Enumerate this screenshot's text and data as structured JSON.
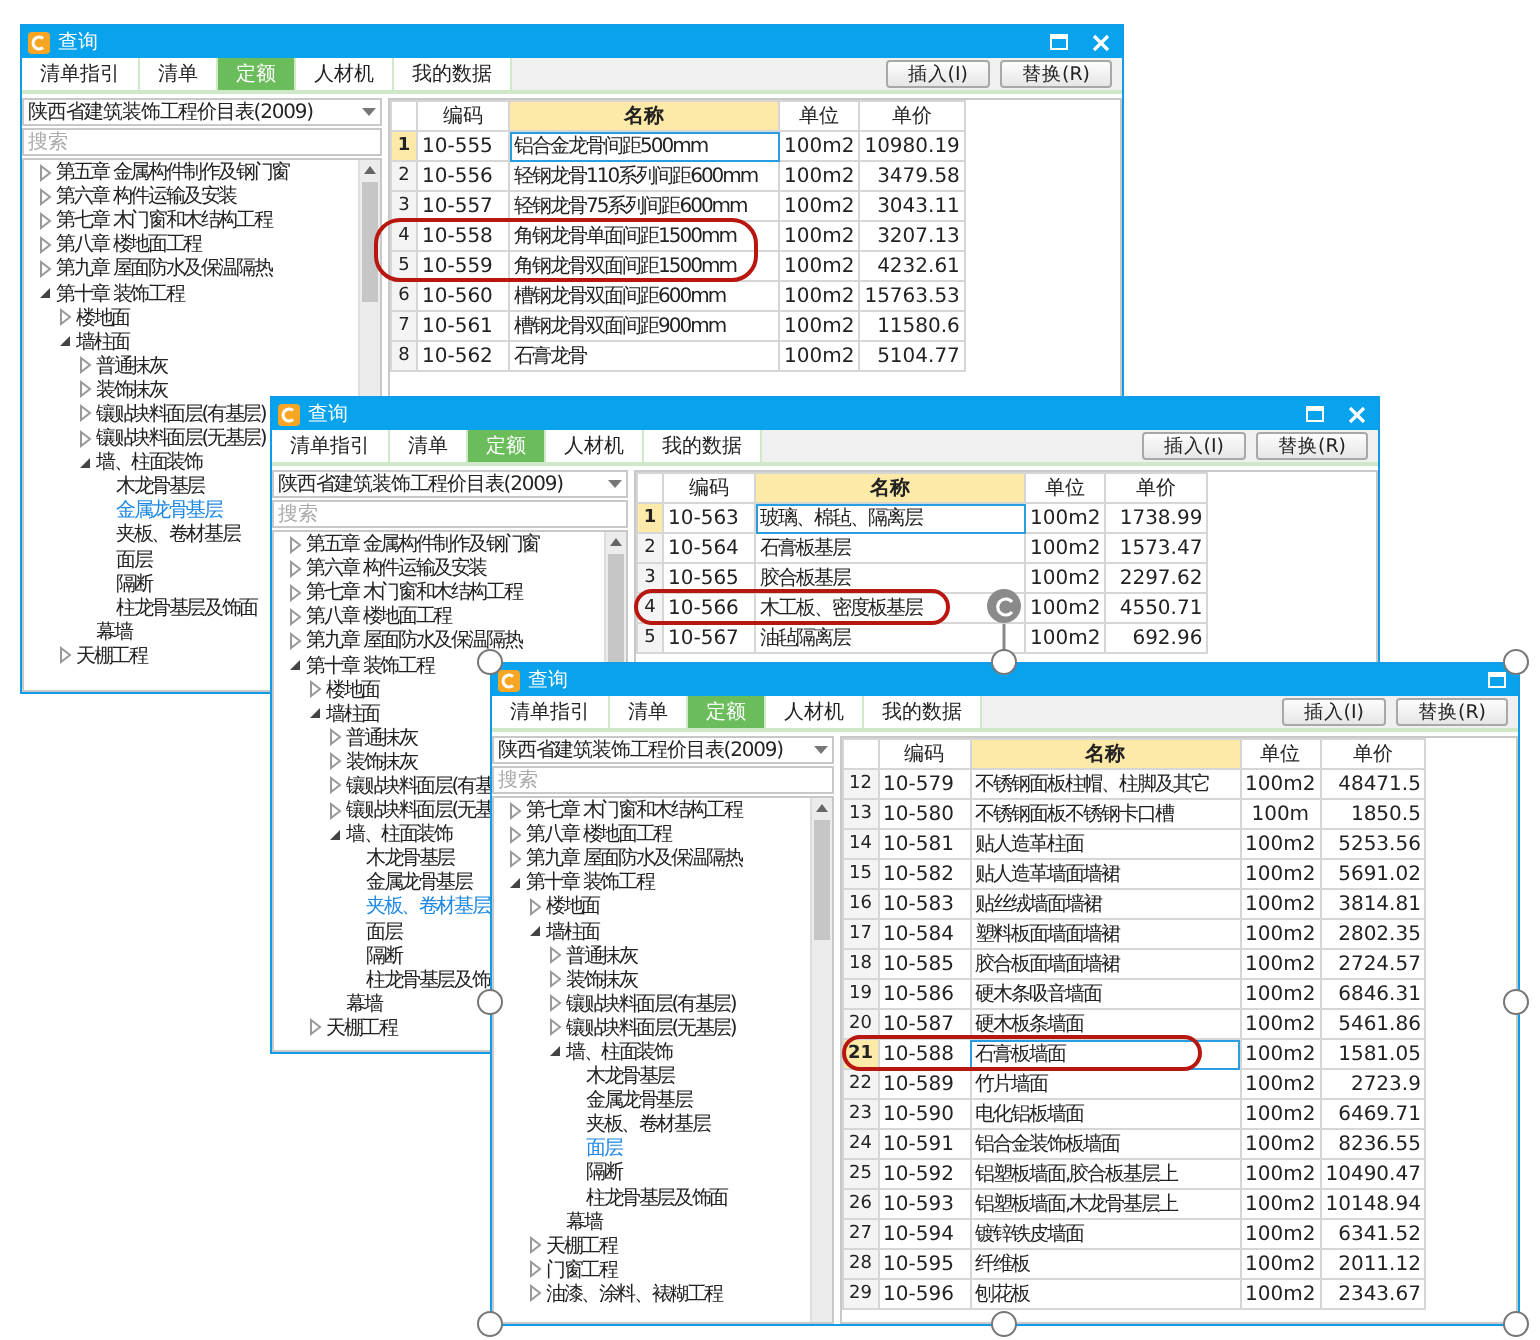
{
  "windows": [
    {
      "title": "查询",
      "tabs": [
        {
          "label": "清单指引",
          "selected": false
        },
        {
          "label": "清单",
          "selected": false
        },
        {
          "label": "定额",
          "selected": true
        },
        {
          "label": "人材机",
          "selected": false
        },
        {
          "label": "我的数据",
          "selected": false
        }
      ],
      "buttons": [
        "插入(I)",
        "替换(R)"
      ],
      "library": "陕西省建筑装饰工程价目表(2009)",
      "search": {
        "placeholder": "搜索"
      },
      "tree": [
        {
          "label": "第五章 金属构件制作及钢门窗",
          "expanded": false,
          "selected": false
        },
        {
          "label": "第六章 构件运输及安装",
          "expanded": false,
          "selected": false
        },
        {
          "label": "第七章 木门窗和木结构工程",
          "expanded": false,
          "selected": false
        },
        {
          "label": "第八章 楼地面工程",
          "expanded": false,
          "selected": false
        },
        {
          "label": "第九章 屋面防水及保温隔热",
          "expanded": false,
          "selected": false
        },
        {
          "label": "第十章 装饰工程",
          "expanded": true,
          "selected": false,
          "children": [
            {
              "label": "楼地面",
              "expanded": false,
              "selected": false
            },
            {
              "label": "墙柱面",
              "expanded": true,
              "selected": false,
              "children": [
                {
                  "label": "普通抹灰",
                  "expanded": false,
                  "selected": false
                },
                {
                  "label": "装饰抹灰",
                  "expanded": false,
                  "selected": false
                },
                {
                  "label": "镶贴块料面层(有基层)",
                  "expanded": false,
                  "selected": false
                },
                {
                  "label": "镶贴块料面层(无基层)",
                  "expanded": false,
                  "selected": false
                },
                {
                  "label": "墙、柱面装饰",
                  "expanded": true,
                  "selected": false,
                  "children": [
                    {
                      "label": "木龙骨基层",
                      "selected": false
                    },
                    {
                      "label": "金属龙骨基层",
                      "selected": true
                    },
                    {
                      "label": "夹板、卷材基层",
                      "selected": false
                    },
                    {
                      "label": "面层",
                      "selected": false
                    },
                    {
                      "label": "隔断",
                      "selected": false
                    },
                    {
                      "label": "柱龙骨基层及饰面",
                      "selected": false
                    }
                  ]
                },
                {
                  "label": "幕墙",
                  "selected": false
                }
              ]
            },
            {
              "label": "天棚工程",
              "expanded": false,
              "selected": false
            }
          ]
        }
      ],
      "table": {
        "columns": [
          {
            "label": "编码",
            "selected": false
          },
          {
            "label": "名称",
            "selected": true
          },
          {
            "label": "单位",
            "selected": false
          },
          {
            "label": "单价",
            "selected": false
          }
        ],
        "rows": [
          {
            "number": "1",
            "code": "10-555",
            "name": "铝合金龙骨间距500mm",
            "unit": "100m2",
            "price": "10980.19",
            "selected": true
          },
          {
            "number": "2",
            "code": "10-556",
            "name": "轻钢龙骨110系列间距600mm",
            "unit": "100m2",
            "price": "3479.58",
            "selected": false
          },
          {
            "number": "3",
            "code": "10-557",
            "name": "轻钢龙骨75系列间距600mm",
            "unit": "100m2",
            "price": "3043.11",
            "selected": false
          },
          {
            "number": "4",
            "code": "10-558",
            "name": "角钢龙骨单面间距1500mm",
            "unit": "100m2",
            "price": "3207.13",
            "selected": false
          },
          {
            "number": "5",
            "code": "10-559",
            "name": "角钢龙骨双面间距1500mm",
            "unit": "100m2",
            "price": "4232.61",
            "selected": false
          },
          {
            "number": "6",
            "code": "10-560",
            "name": "槽钢龙骨双面间距600mm",
            "unit": "100m2",
            "price": "15763.53",
            "selected": false
          },
          {
            "number": "7",
            "code": "10-561",
            "name": "槽钢龙骨双面间距900mm",
            "unit": "100m2",
            "price": "11580.6",
            "selected": false
          },
          {
            "number": "8",
            "code": "10-562",
            "name": "石膏龙骨",
            "unit": "100m2",
            "price": "5104.77",
            "selected": false
          }
        ]
      }
    },
    {
      "title": "查询",
      "tabs": [
        {
          "label": "清单指引",
          "selected": false
        },
        {
          "label": "清单",
          "selected": false
        },
        {
          "label": "定额",
          "selected": true
        },
        {
          "label": "人材机",
          "selected": false
        },
        {
          "label": "我的数据",
          "selected": false
        }
      ],
      "buttons": [
        "插入(I)",
        "替换(R)"
      ],
      "library": "陕西省建筑装饰工程价目表(2009)",
      "search": {
        "placeholder": "搜索"
      },
      "tree": [
        {
          "label": "第五章 金属构件制作及钢门窗",
          "expanded": false,
          "selected": false
        },
        {
          "label": "第六章 构件运输及安装",
          "expanded": false,
          "selected": false
        },
        {
          "label": "第七章 木门窗和木结构工程",
          "expanded": false,
          "selected": false
        },
        {
          "label": "第八章 楼地面工程",
          "expanded": false,
          "selected": false
        },
        {
          "label": "第九章 屋面防水及保温隔热",
          "expanded": false,
          "selected": false
        },
        {
          "label": "第十章 装饰工程",
          "expanded": true,
          "selected": false,
          "children": [
            {
              "label": "楼地面",
              "expanded": false,
              "selected": false
            },
            {
              "label": "墙柱面",
              "expanded": true,
              "selected": false,
              "children": [
                {
                  "label": "普通抹灰",
                  "expanded": false,
                  "selected": false
                },
                {
                  "label": "装饰抹灰",
                  "expanded": false,
                  "selected": false
                },
                {
                  "label": "镶贴块料面层(有基",
                  "expanded": false,
                  "selected": false
                },
                {
                  "label": "镶贴块料面层(无基",
                  "expanded": false,
                  "selected": false
                },
                {
                  "label": "墙、柱面装饰",
                  "expanded": true,
                  "selected": false,
                  "children": [
                    {
                      "label": "木龙骨基层",
                      "selected": false
                    },
                    {
                      "label": "金属龙骨基层",
                      "selected": false
                    },
                    {
                      "label": "夹板、卷材基层",
                      "selected": true
                    },
                    {
                      "label": "面层",
                      "selected": false
                    },
                    {
                      "label": "隔断",
                      "selected": false
                    },
                    {
                      "label": "柱龙骨基层及饰",
                      "selected": false
                    }
                  ]
                },
                {
                  "label": "幕墙",
                  "selected": false
                }
              ]
            },
            {
              "label": "天棚工程",
              "expanded": false,
              "selected": false
            }
          ]
        }
      ],
      "table": {
        "columns": [
          {
            "label": "编码",
            "selected": false
          },
          {
            "label": "名称",
            "selected": true
          },
          {
            "label": "单位",
            "selected": false
          },
          {
            "label": "单价",
            "selected": false
          }
        ],
        "rows": [
          {
            "number": "1",
            "code": "10-563",
            "name": "玻璃、棉毡、隔离层",
            "unit": "100m2",
            "price": "1738.99",
            "selected": true
          },
          {
            "number": "2",
            "code": "10-564",
            "name": "石膏板基层",
            "unit": "100m2",
            "price": "1573.47",
            "selected": false
          },
          {
            "number": "3",
            "code": "10-565",
            "name": "胶合板基层",
            "unit": "100m2",
            "price": "2297.62",
            "selected": false
          },
          {
            "number": "4",
            "code": "10-566",
            "name": "木工板、密度板基层",
            "unit": "100m2",
            "price": "4550.71",
            "selected": false
          },
          {
            "number": "5",
            "code": "10-567",
            "name": "油毡隔离层",
            "unit": "100m2",
            "price": "692.96",
            "selected": false
          }
        ]
      }
    },
    {
      "title": "查询",
      "tabs": [
        {
          "label": "清单指引",
          "selected": false
        },
        {
          "label": "清单",
          "selected": false
        },
        {
          "label": "定额",
          "selected": true
        },
        {
          "label": "人材机",
          "selected": false
        },
        {
          "label": "我的数据",
          "selected": false
        }
      ],
      "buttons": [
        "插入(I)",
        "替换(R)"
      ],
      "library": "陕西省建筑装饰工程价目表(2009)",
      "search": {
        "placeholder": "搜索"
      },
      "tree": [
        {
          "label": "第七章 木门窗和木结构工程",
          "expanded": false,
          "selected": false
        },
        {
          "label": "第八章 楼地面工程",
          "expanded": false,
          "selected": false
        },
        {
          "label": "第九章 屋面防水及保温隔热",
          "expanded": false,
          "selected": false
        },
        {
          "label": "第十章 装饰工程",
          "expanded": true,
          "selected": false,
          "children": [
            {
              "label": "楼地面",
              "expanded": false,
              "selected": false
            },
            {
              "label": "墙柱面",
              "expanded": true,
              "selected": false,
              "children": [
                {
                  "label": "普通抹灰",
                  "expanded": false,
                  "selected": false
                },
                {
                  "label": "装饰抹灰",
                  "expanded": false,
                  "selected": false
                },
                {
                  "label": "镶贴块料面层(有基层)",
                  "expanded": false,
                  "selected": false
                },
                {
                  "label": "镶贴块料面层(无基层)",
                  "expanded": false,
                  "selected": false
                },
                {
                  "label": "墙、柱面装饰",
                  "expanded": true,
                  "selected": false,
                  "children": [
                    {
                      "label": "木龙骨基层",
                      "selected": false
                    },
                    {
                      "label": "金属龙骨基层",
                      "selected": false
                    },
                    {
                      "label": "夹板、卷材基层",
                      "selected": false
                    },
                    {
                      "label": "面层",
                      "selected": true
                    },
                    {
                      "label": "隔断",
                      "selected": false
                    },
                    {
                      "label": "柱龙骨基层及饰面",
                      "selected": false
                    }
                  ]
                },
                {
                  "label": "幕墙",
                  "selected": false
                }
              ]
            },
            {
              "label": "天棚工程",
              "expanded": false,
              "selected": false
            },
            {
              "label": "门窗工程",
              "expanded": false,
              "selected": false
            },
            {
              "label": "油漆、涂料、裱糊工程",
              "expanded": false,
              "selected": false
            }
          ]
        }
      ],
      "table": {
        "columns": [
          {
            "label": "编码",
            "selected": false
          },
          {
            "label": "名称",
            "selected": true
          },
          {
            "label": "单位",
            "selected": false
          },
          {
            "label": "单价",
            "selected": false
          }
        ],
        "rows": [
          {
            "number": "12",
            "code": "10-579",
            "name": "不锈钢面板柱帽、柱脚及其它",
            "unit": "100m2",
            "price": "48471.5",
            "selected": false
          },
          {
            "number": "13",
            "code": "10-580",
            "name": "不锈钢面板不锈钢卡口槽",
            "unit": "100m",
            "price": "1850.5",
            "selected": false
          },
          {
            "number": "14",
            "code": "10-581",
            "name": "贴人造革柱面",
            "unit": "100m2",
            "price": "5253.56",
            "selected": false
          },
          {
            "number": "15",
            "code": "10-582",
            "name": "贴人造革墙面墙裙",
            "unit": "100m2",
            "price": "5691.02",
            "selected": false
          },
          {
            "number": "16",
            "code": "10-583",
            "name": "贴丝绒墙面墙裙",
            "unit": "100m2",
            "price": "3814.81",
            "selected": false
          },
          {
            "number": "17",
            "code": "10-584",
            "name": "塑料板面墙面墙裙",
            "unit": "100m2",
            "price": "2802.35",
            "selected": false
          },
          {
            "number": "18",
            "code": "10-585",
            "name": "胶合板面墙面墙裙",
            "unit": "100m2",
            "price": "2724.57",
            "selected": false
          },
          {
            "number": "19",
            "code": "10-586",
            "name": "硬木条吸音墙面",
            "unit": "100m2",
            "price": "6846.31",
            "selected": false
          },
          {
            "number": "20",
            "code": "10-587",
            "name": "硬木板条墙面",
            "unit": "100m2",
            "price": "5461.86",
            "selected": false
          },
          {
            "number": "21",
            "code": "10-588",
            "name": "石膏板墙面",
            "unit": "100m2",
            "price": "1581.05",
            "selected": true
          },
          {
            "number": "22",
            "code": "10-589",
            "name": "竹片墙面",
            "unit": "100m2",
            "price": "2723.9",
            "selected": false
          },
          {
            "number": "23",
            "code": "10-590",
            "name": "电化铝板墙面",
            "unit": "100m2",
            "price": "6469.71",
            "selected": false
          },
          {
            "number": "24",
            "code": "10-591",
            "name": "铝合金装饰板墙面",
            "unit": "100m2",
            "price": "8236.55",
            "selected": false
          },
          {
            "number": "25",
            "code": "10-592",
            "name": "铝塑板墙面,胶合板基层上",
            "unit": "100m2",
            "price": "10490.47",
            "selected": false
          },
          {
            "number": "26",
            "code": "10-593",
            "name": "铝塑板墙面,木龙骨基层上",
            "unit": "100m2",
            "price": "10148.94",
            "selected": false
          },
          {
            "number": "27",
            "code": "10-594",
            "name": "镀锌铁皮墙面",
            "unit": "100m2",
            "price": "6341.52",
            "selected": false
          },
          {
            "number": "28",
            "code": "10-595",
            "name": "纤维板",
            "unit": "100m2",
            "price": "2011.12",
            "selected": false
          },
          {
            "number": "29",
            "code": "10-596",
            "name": "刨花板",
            "unit": "100m2",
            "price": "2343.67",
            "selected": false
          }
        ]
      }
    }
  ]
}
